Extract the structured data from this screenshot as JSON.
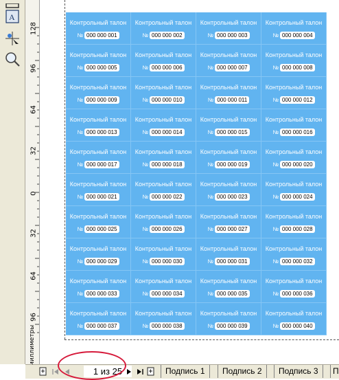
{
  "ruler": {
    "labels": [
      "128",
      "96",
      "64",
      "32",
      "0",
      "32",
      "64",
      "96"
    ],
    "unit": "миллиметры"
  },
  "ticket_title": "Контрольный талон",
  "number_prefix": "№",
  "tickets": [
    "000 000 001",
    "000 000 002",
    "000 000 003",
    "000 000 004",
    "000 000 005",
    "000 000 006",
    "000 000 007",
    "000 000 008",
    "000 000 009",
    "000 000 010",
    "000 000 011",
    "000 000 012",
    "000 000 013",
    "000 000 014",
    "000 000 015",
    "000 000 016",
    "000 000 017",
    "000 000 018",
    "000 000 019",
    "000 000 020",
    "000 000 021",
    "000 000 022",
    "000 000 023",
    "000 000 024",
    "000 000 025",
    "000 000 026",
    "000 000 027",
    "000 000 028",
    "000 000 029",
    "000 000 030",
    "000 000 031",
    "000 000 032",
    "000 000 033",
    "000 000 034",
    "000 000 035",
    "000 000 036",
    "000 000 037",
    "000 000 038",
    "000 000 039",
    "000 000 040"
  ],
  "statusbar": {
    "page_indicator": "1 из 25",
    "page_tabs": [
      "Подпись 1",
      "Подпись 2",
      "Подпись 3",
      "П"
    ]
  },
  "colors": {
    "ticket_bg": "#61b4f0",
    "highlight_ellipse": "#d6193a"
  },
  "icons": {
    "tool_1": "text-frame-icon",
    "tool_2": "interactive-fill-icon",
    "tool_3": "color-eyedropper-icon",
    "tool_4": "zoom-icon",
    "nav": [
      "add-page-icon",
      "first-page-icon",
      "prev-page-icon",
      "next-page-icon",
      "last-page-icon",
      "add-page-end-icon"
    ]
  }
}
